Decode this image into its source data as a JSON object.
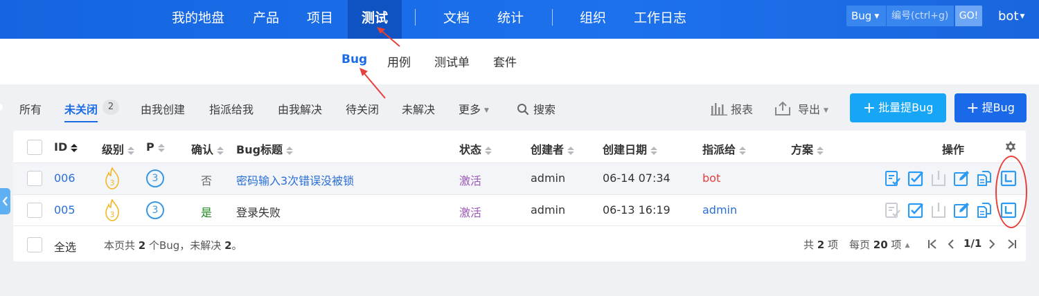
{
  "topnav": {
    "items": [
      "我的地盘",
      "产品",
      "项目",
      "测试",
      "文档",
      "统计",
      "组织",
      "工作日志"
    ],
    "active": "测试"
  },
  "search": {
    "type_label": "Bug",
    "placeholder": "编号(ctrl+g)",
    "go_label": "GO!"
  },
  "user": {
    "name": "bot"
  },
  "subnav": {
    "items": [
      "Bug",
      "用例",
      "测试单",
      "套件"
    ],
    "active": "Bug"
  },
  "featurebar": {
    "items": [
      "所有",
      "未关闭",
      "由我创建",
      "指派给我",
      "由我解决",
      "待关闭",
      "未解决",
      "更多"
    ],
    "active": "未关闭",
    "active_count": "2",
    "search_label": "搜索",
    "report_label": "报表",
    "export_label": "导出",
    "batch_create_label": "批量提Bug",
    "create_label": "提Bug"
  },
  "table": {
    "columns": {
      "id": "ID",
      "severity": "级别",
      "pri": "P",
      "confirmed": "确认",
      "title": "Bug标题",
      "status": "状态",
      "opened_by": "创建者",
      "opened_date": "创建日期",
      "assigned_to": "指派给",
      "resolution": "方案",
      "actions": "操作"
    },
    "rows": [
      {
        "id": "006",
        "severity": "3",
        "pri": "3",
        "confirmed": "否",
        "title": "密码输入3次错误没被锁",
        "status": "激活",
        "opened_by": "admin",
        "opened_date": "06-14 07:34",
        "assigned_to": "bot",
        "resolution": ""
      },
      {
        "id": "005",
        "severity": "3",
        "pri": "3",
        "confirmed": "是",
        "title": "登录失败",
        "status": "激活",
        "opened_by": "admin",
        "opened_date": "06-13 16:19",
        "assigned_to": "admin",
        "resolution": ""
      }
    ]
  },
  "footer": {
    "select_all": "全选",
    "summary_prefix": "本页共 ",
    "summary_count": "2",
    "summary_mid": " 个Bug，未解决 ",
    "summary_unresolved": "2",
    "summary_suffix": "。",
    "total_prefix": "共 ",
    "total": "2",
    "total_suffix": " 项",
    "per_page_prefix": "每页 ",
    "per_page": "20",
    "per_page_suffix": " 项",
    "page_indicator": "1/1"
  },
  "colors": {
    "topbar": "#1a6ae6",
    "accent": "#1b6ce4",
    "status_active": "#9b59b6",
    "assigned_self": "#e5403b",
    "annotation": "#e5403b"
  }
}
